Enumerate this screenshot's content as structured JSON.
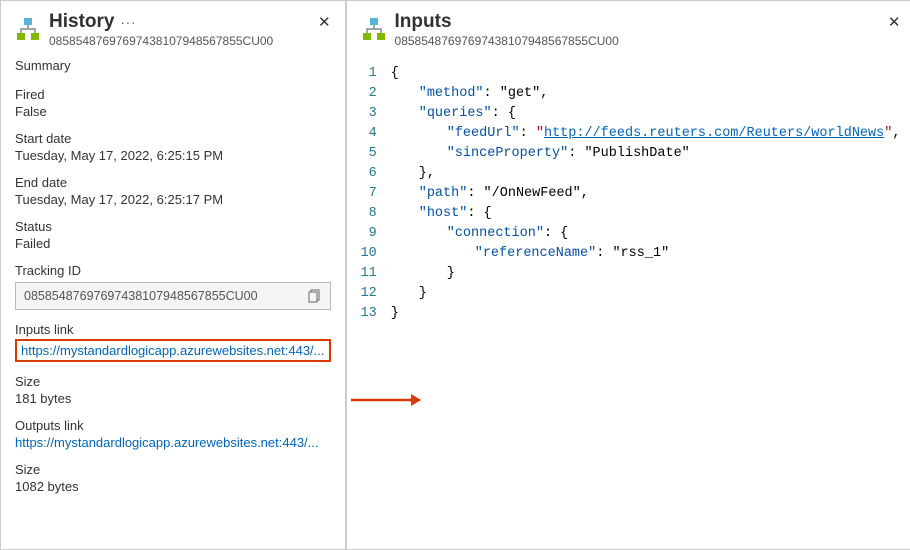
{
  "history": {
    "title": "History",
    "sub_id": "08585487697697438107948567855CU00",
    "summary_label": "Summary",
    "fired_label": "Fired",
    "fired_value": "False",
    "start_date_label": "Start date",
    "start_date_value": "Tuesday, May 17, 2022, 6:25:15 PM",
    "end_date_label": "End date",
    "end_date_value": "Tuesday, May 17, 2022, 6:25:17 PM",
    "status_label": "Status",
    "status_value": "Failed",
    "tracking_id_label": "Tracking ID",
    "tracking_id_value": "08585487697697438107948567855CU00",
    "inputs_link_label": "Inputs link",
    "inputs_link_value": "https://mystandardlogicapp.azurewebsites.net:443/...",
    "inputs_size_label": "Size",
    "inputs_size_value": "181 bytes",
    "outputs_link_label": "Outputs link",
    "outputs_link_value": "https://mystandardlogicapp.azurewebsites.net:443/...",
    "outputs_size_label": "Size",
    "outputs_size_value": "1082 bytes"
  },
  "inputs": {
    "title": "Inputs",
    "sub_id": "08585487697697438107948567855CU00",
    "json": {
      "method": "get",
      "queries": {
        "feedUrl": "http://feeds.reuters.com/Reuters/worldNews",
        "sinceProperty": "PublishDate"
      },
      "path": "/OnNewFeed",
      "host": {
        "connection": {
          "referenceName": "rss_1"
        }
      }
    },
    "code_lines": [
      "{",
      "  \"method\": \"get\",",
      "  \"queries\": {",
      "    \"feedUrl\": \"http://feeds.reuters.com/Reuters/worldNews\",",
      "    \"sinceProperty\": \"PublishDate\"",
      "  },",
      "  \"path\": \"/OnNewFeed\",",
      "  \"host\": {",
      "    \"connection\": {",
      "      \"referenceName\": \"rss_1\"",
      "    }",
      "  }",
      "}"
    ]
  },
  "colors": {
    "link": "#0066b8",
    "callout": "#d83b01",
    "json_key": "#0451a5",
    "json_string": "#a31515"
  }
}
